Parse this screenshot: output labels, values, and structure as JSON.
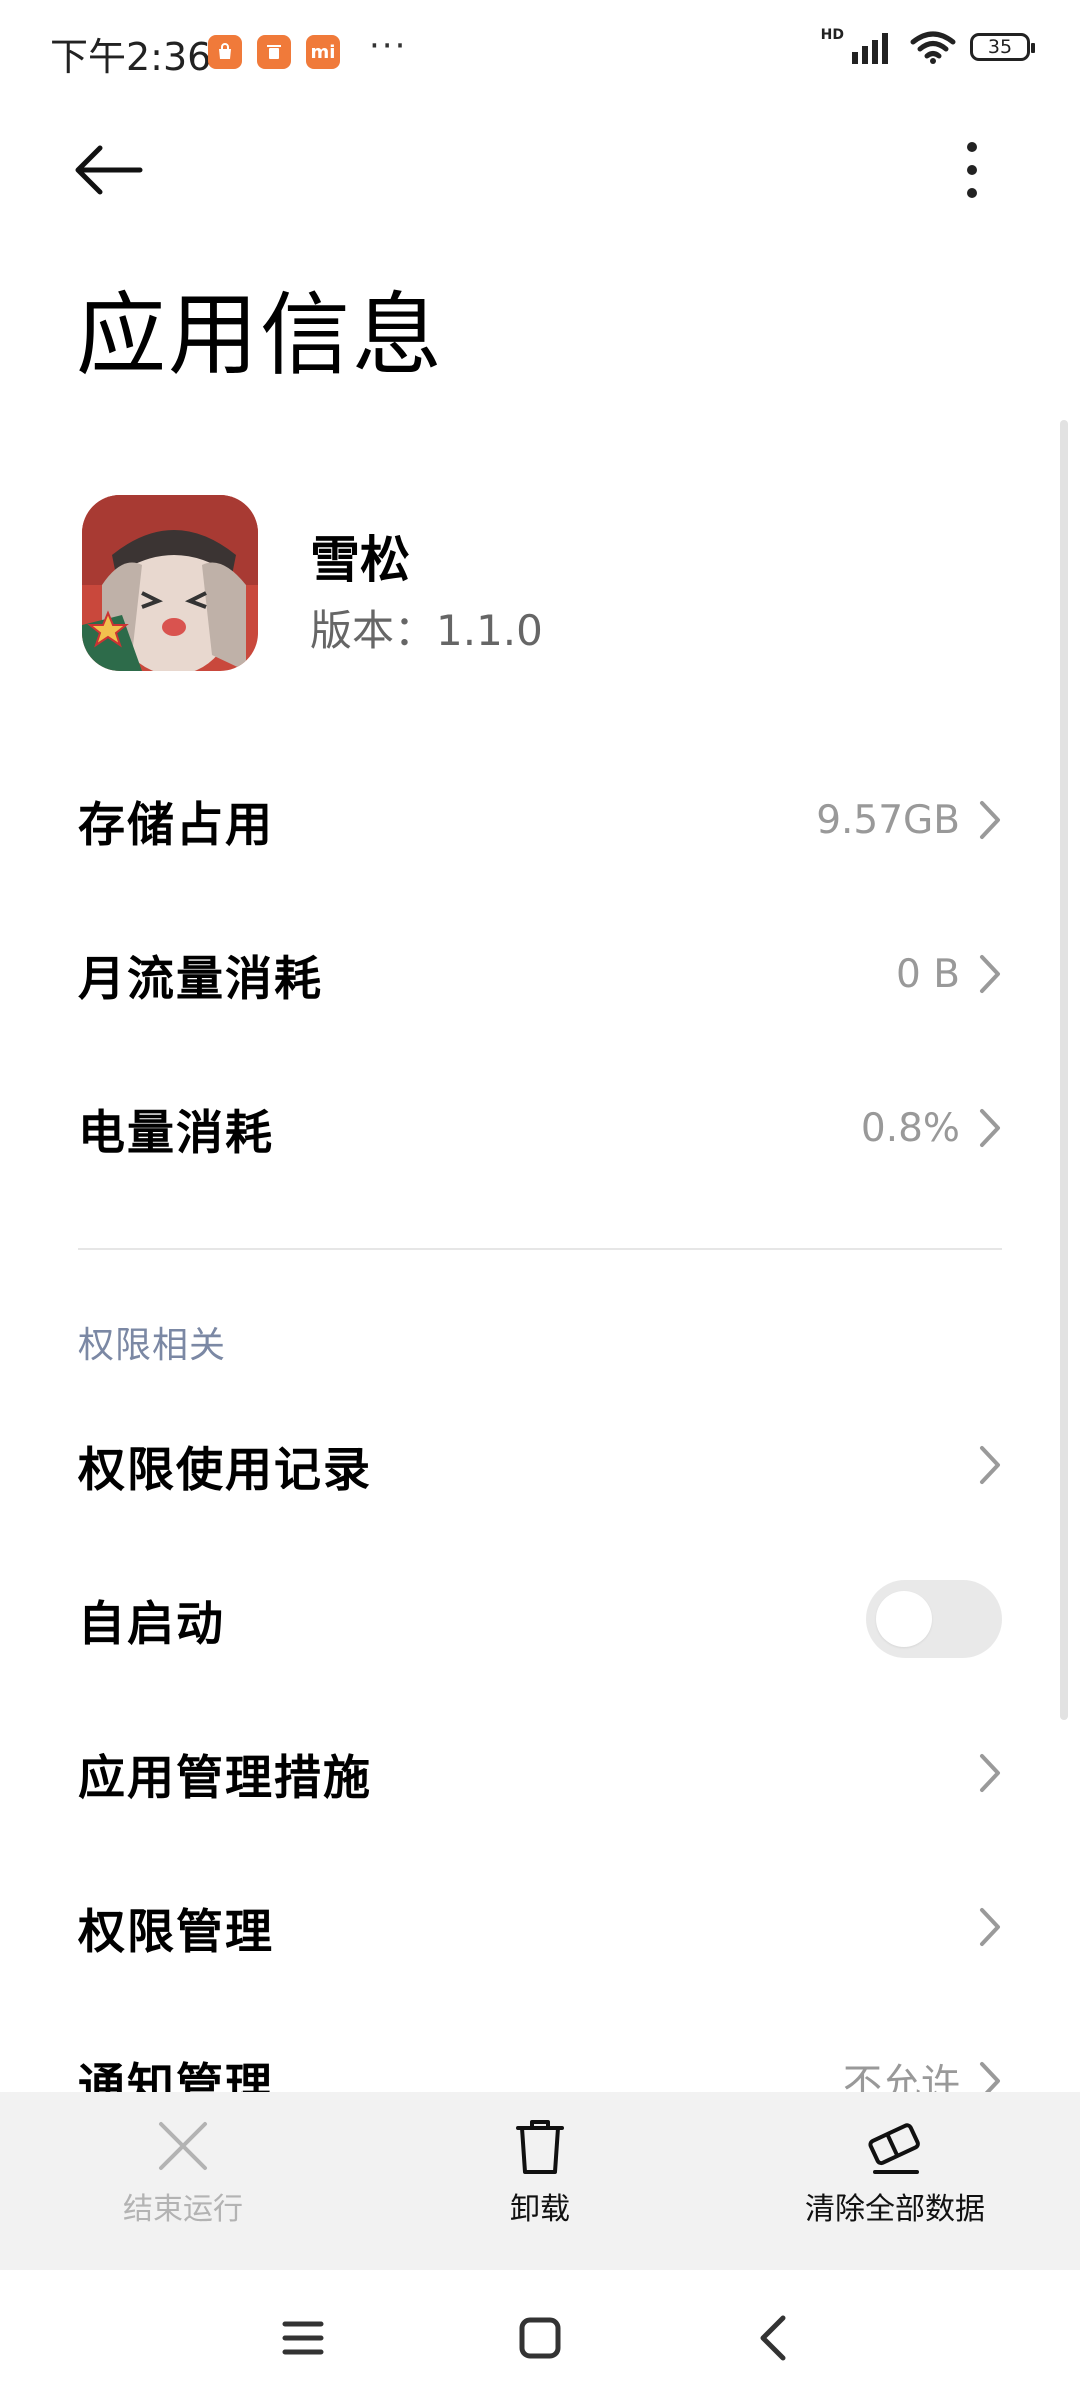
{
  "status_bar": {
    "time": "下午2:36",
    "notification_icons": [
      "store-icon",
      "clean-icon",
      "mi-icon"
    ],
    "mi_text": "mi",
    "more": "···",
    "hd": "HD",
    "battery": "35"
  },
  "header": {
    "back_icon": "arrow-left-icon",
    "menu_icon": "more-vert-icon",
    "title": "应用信息"
  },
  "app": {
    "name": "雪松",
    "version": "版本：1.1.0"
  },
  "usage_rows": [
    {
      "label": "存储占用",
      "value": "9.57GB"
    },
    {
      "label": "月流量消耗",
      "value": "0 B"
    },
    {
      "label": "电量消耗",
      "value": "0.8%"
    }
  ],
  "permissions": {
    "section_title": "权限相关",
    "rows": [
      {
        "label": "权限使用记录",
        "value": ""
      },
      {
        "label": "自启动",
        "autostart_on": false
      },
      {
        "label": "应用管理措施",
        "value": ""
      },
      {
        "label": "权限管理",
        "value": ""
      },
      {
        "label": "通知管理",
        "value": "不允许"
      }
    ]
  },
  "actions": {
    "stop": "结束运行",
    "uninstall": "卸载",
    "clear": "清除全部数据"
  },
  "nav": [
    "menu-icon",
    "home-icon",
    "back-icon"
  ],
  "colors": {
    "section_title": "#7b88a4",
    "value_gray": "#999999",
    "action_bar_bg": "#f2f2f2",
    "toggle_off": "#e9e9e9"
  }
}
